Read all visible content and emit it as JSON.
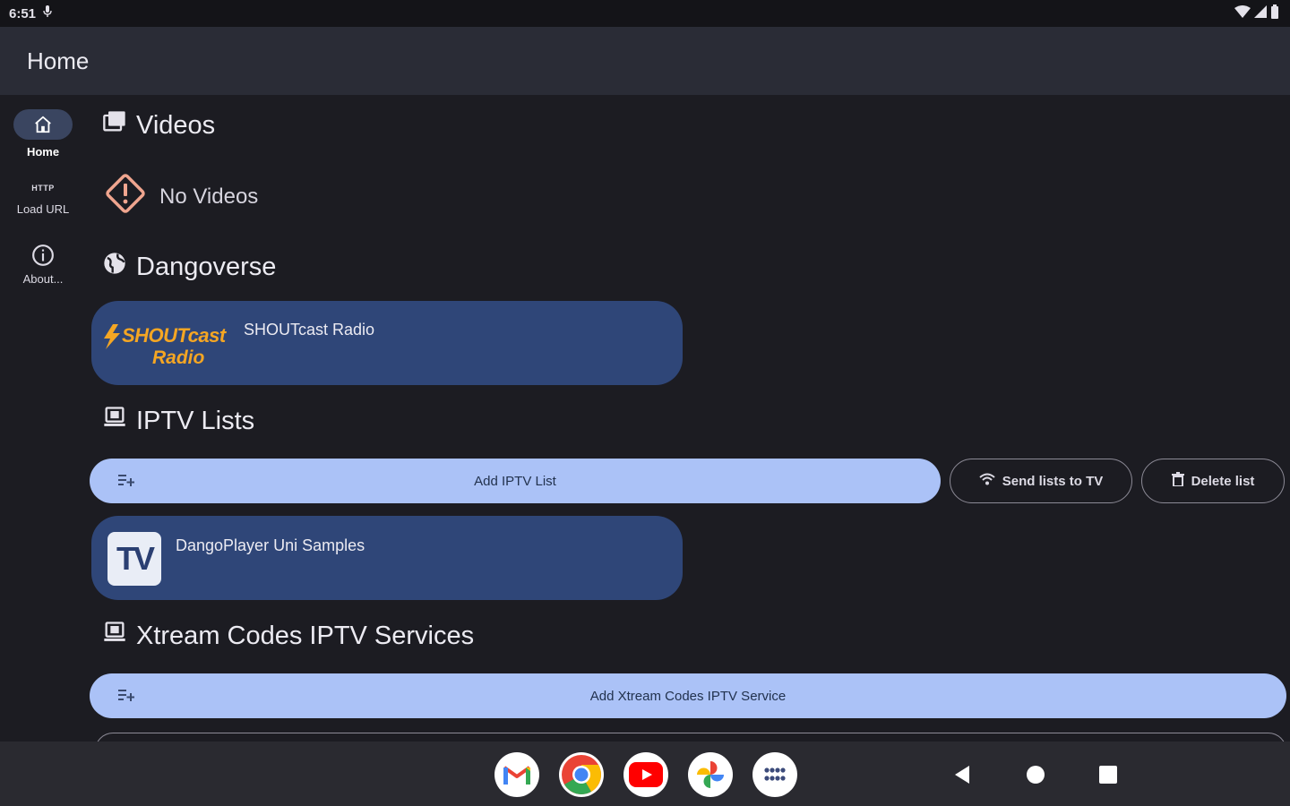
{
  "status_bar": {
    "time": "6:51"
  },
  "app_bar": {
    "title": "Home"
  },
  "rail": {
    "items": [
      {
        "label": "Home",
        "icon": "home-icon",
        "active": true
      },
      {
        "label": "Load URL",
        "icon": "http-icon",
        "tag": "HTTP"
      },
      {
        "label": "About...",
        "icon": "info-icon"
      }
    ]
  },
  "sections": {
    "videos": {
      "title": "Videos",
      "empty_text": "No Videos"
    },
    "dangoverse": {
      "title": "Dangoverse",
      "card": {
        "title": "SHOUTcast Radio",
        "logo_line1": "SHOUTcast",
        "logo_line2": "Radio"
      }
    },
    "iptv_lists": {
      "title": "IPTV Lists",
      "add_label": "Add IPTV List",
      "send_label": "Send lists to TV",
      "delete_label": "Delete list",
      "card": {
        "title": "DangoPlayer Uni Samples",
        "logo_text": "TV"
      }
    },
    "xtream": {
      "title": "Xtream Codes IPTV Services",
      "add_label": "Add Xtream Codes IPTV Service"
    }
  },
  "dock": {
    "apps": [
      "gmail-icon",
      "chrome-icon",
      "youtube-icon",
      "photos-icon",
      "app-drawer-icon"
    ]
  },
  "colors": {
    "background": "#1c1c22",
    "app_bar": "#2a2c36",
    "card": "#2f4678",
    "primary_button": "#abc2f7",
    "logo_orange": "#f5a623"
  }
}
